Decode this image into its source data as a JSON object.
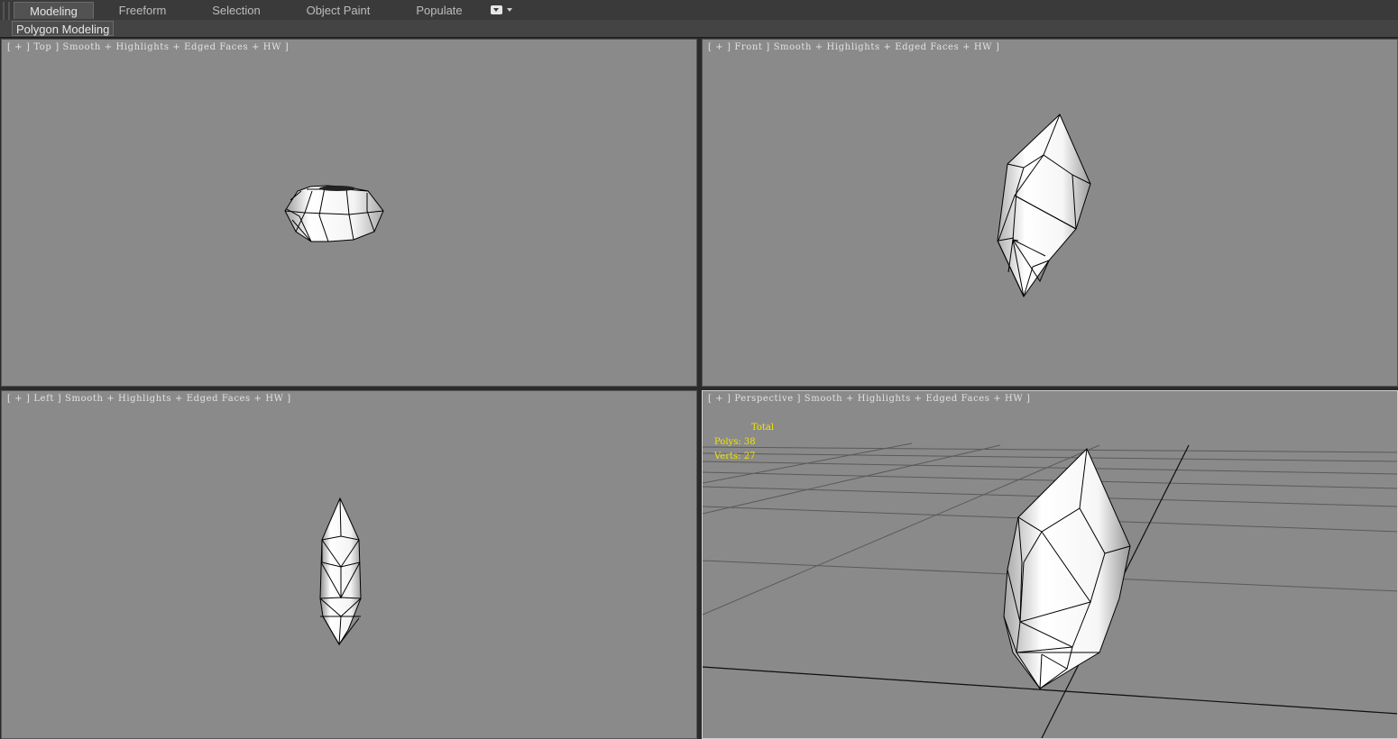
{
  "ribbon": {
    "tabs": [
      {
        "label": "Modeling",
        "active": true
      },
      {
        "label": "Freeform",
        "active": false
      },
      {
        "label": "Selection",
        "active": false
      },
      {
        "label": "Populate",
        "active": false
      },
      {
        "label": "Object Paint",
        "active": false
      }
    ],
    "panel_title": "Polygon Modeling"
  },
  "viewports": {
    "top": {
      "label": "[ + ] Top ] Smooth + Highlights + Edged Faces + HW ]"
    },
    "front": {
      "label": "[ + ] Front ] Smooth + Highlights + Edged Faces + HW ]"
    },
    "left": {
      "label": "[ + ] Left ] Smooth + Highlights + Edged Faces + HW ]"
    },
    "perspective": {
      "label": "[ + ] Perspective ] Smooth + Highlights + Edged Faces + HW ]"
    }
  },
  "stats": {
    "header": "Total",
    "polys": "Polys: 38",
    "verts": "Verts: 27"
  },
  "colors": {
    "viewport_bg": "#8a8a8a",
    "stats_text": "#f2e600",
    "active_viewport_border": "#cfcfcf"
  }
}
